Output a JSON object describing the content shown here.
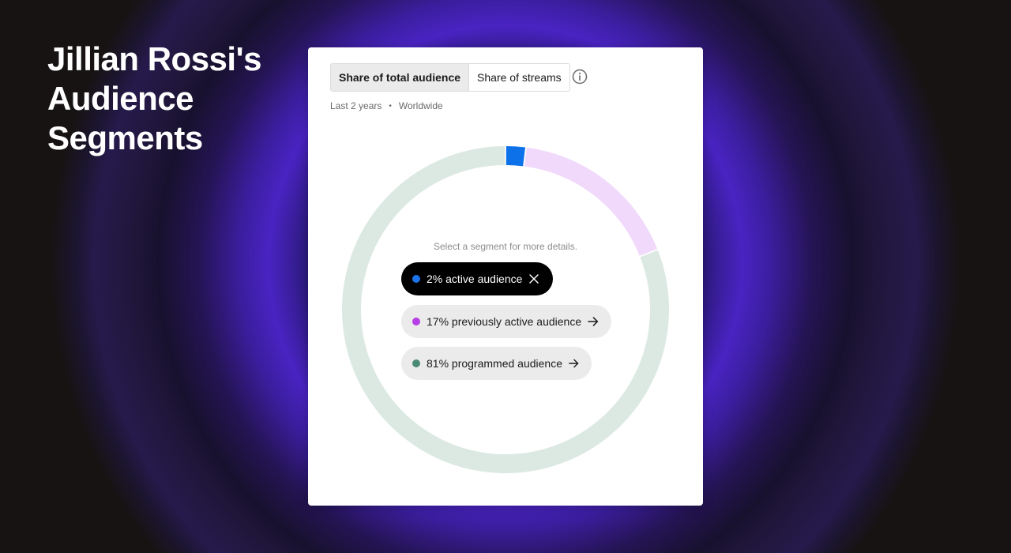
{
  "page": {
    "title": "Jillian Rossi's Audience Segments"
  },
  "card": {
    "tabs": [
      {
        "label": "Share of total audience",
        "active": true
      },
      {
        "label": "Share of streams",
        "active": false
      }
    ],
    "info_icon": "info-circle-icon",
    "meta": {
      "period": "Last 2 years",
      "region": "Worldwide"
    },
    "hint": "Select a segment for more details."
  },
  "segments": [
    {
      "label": "2% active audience",
      "percent": 2,
      "color": "#1a73e8",
      "icon": "close-icon",
      "selected": true
    },
    {
      "label": "17% previously active audience",
      "percent": 17,
      "color": "#b63fe6",
      "icon": "arrow-right-icon",
      "selected": false
    },
    {
      "label": "81% programmed audience",
      "percent": 81,
      "color": "#4b8a73",
      "icon": "arrow-right-icon",
      "selected": false
    }
  ],
  "ring_colors": {
    "active": "#0d72ea",
    "previously_active": "#f1d9fb",
    "programmed": "#dce9e3"
  }
}
